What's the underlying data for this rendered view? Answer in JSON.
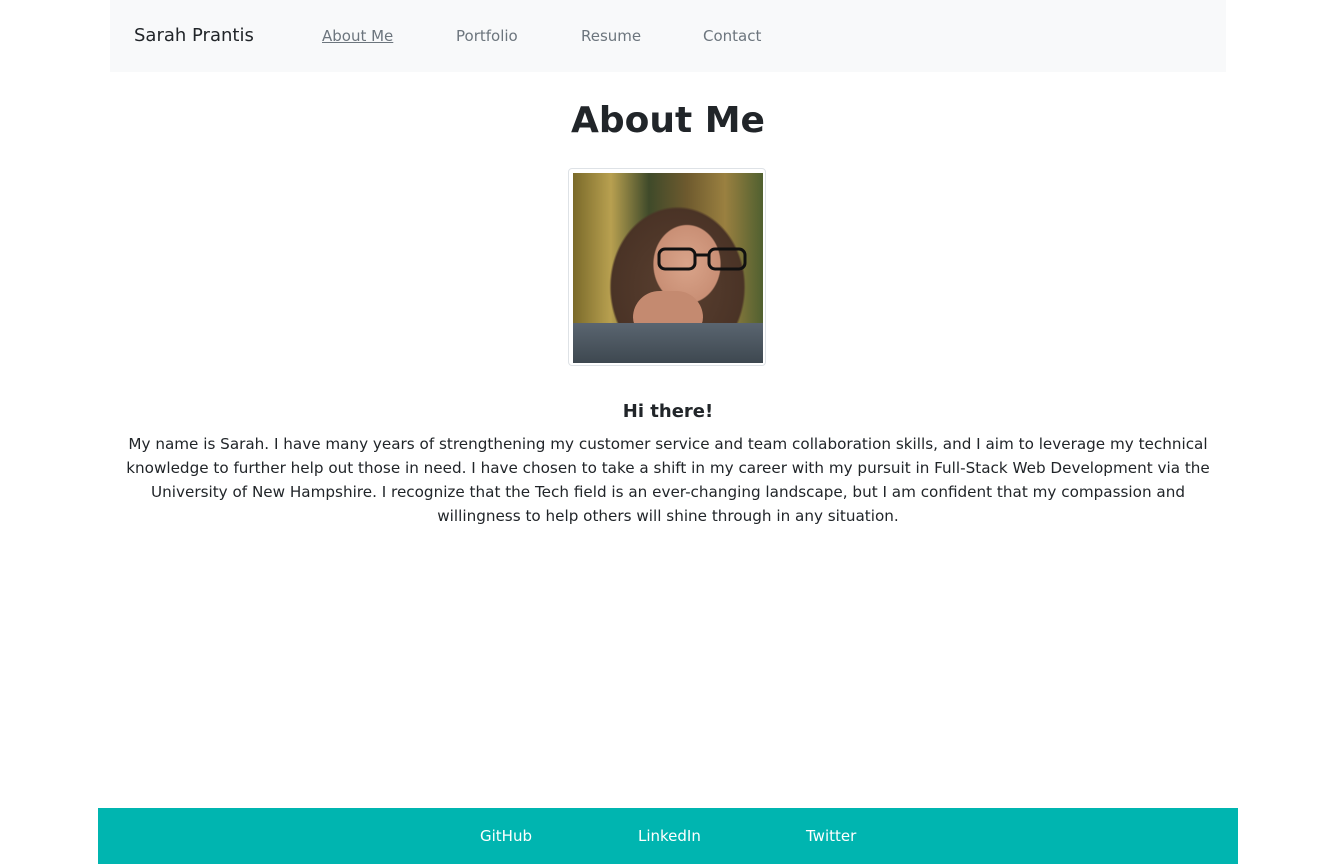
{
  "navbar": {
    "brand": "Sarah Prantis",
    "links": [
      {
        "label": "About Me",
        "active": true
      },
      {
        "label": "Portfolio",
        "active": false
      },
      {
        "label": "Resume",
        "active": false
      },
      {
        "label": "Contact",
        "active": false
      }
    ]
  },
  "main": {
    "title": "About Me",
    "greeting": "Hi there!",
    "bio": "My name is Sarah. I have many years of strengthening my customer service and team collaboration skills, and I aim to leverage my technical knowledge to further help out those in need. I have chosen to take a shift in my career with my pursuit in Full-Stack Web Development via the University of New Hampshire. I recognize that the Tech field is an ever-changing landscape, but I am confident that my compassion and willingness to help others will shine through in any situation."
  },
  "footer": {
    "links": [
      "GitHub",
      "LinkedIn",
      "Twitter"
    ]
  },
  "colors": {
    "navbar_bg": "#f8f9fa",
    "footer_bg": "#00b5b0",
    "link_muted": "#6c757d"
  }
}
